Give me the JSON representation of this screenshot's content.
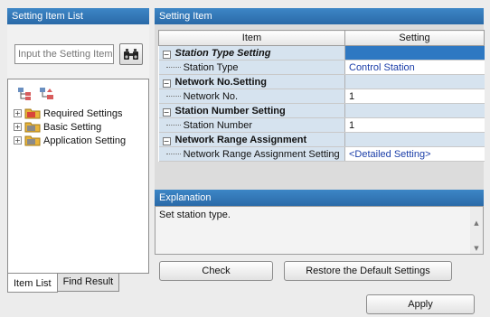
{
  "left_pane": {
    "title": "Setting Item List",
    "search_placeholder": "Input the Setting Item t",
    "tree": [
      {
        "label": "Required Settings"
      },
      {
        "label": "Basic Setting"
      },
      {
        "label": "Application Setting"
      }
    ],
    "tabs": [
      {
        "label": "Item List",
        "active": true
      },
      {
        "label": "Find Result",
        "active": false
      }
    ]
  },
  "right_pane": {
    "title": "Setting Item",
    "columns": {
      "item": "Item",
      "setting": "Setting"
    },
    "rows": [
      {
        "item": "Station Type Setting",
        "setting": "",
        "group": true,
        "italic": true,
        "selected": true
      },
      {
        "item": "Station Type",
        "setting": "Control Station",
        "group": false,
        "link": true
      },
      {
        "item": "Network No.Setting",
        "setting": "",
        "group": true
      },
      {
        "item": "Network No.",
        "setting": "1",
        "group": false
      },
      {
        "item": "Station Number Setting",
        "setting": "",
        "group": true
      },
      {
        "item": "Station Number",
        "setting": "1",
        "group": false
      },
      {
        "item": "Network Range Assignment",
        "setting": "",
        "group": true
      },
      {
        "item": "Network Range Assignment Setting",
        "setting": "<Detailed Setting>",
        "group": false,
        "link": true
      }
    ],
    "explanation_title": "Explanation",
    "explanation_text": "Set station type.",
    "check_label": "Check",
    "restore_label": "Restore the Default Settings"
  },
  "footer": {
    "apply_label": "Apply"
  },
  "colors": {
    "header_blue": "#2e78c2",
    "group_bg": "#d6e3ef",
    "link_blue": "#1a3da8"
  }
}
